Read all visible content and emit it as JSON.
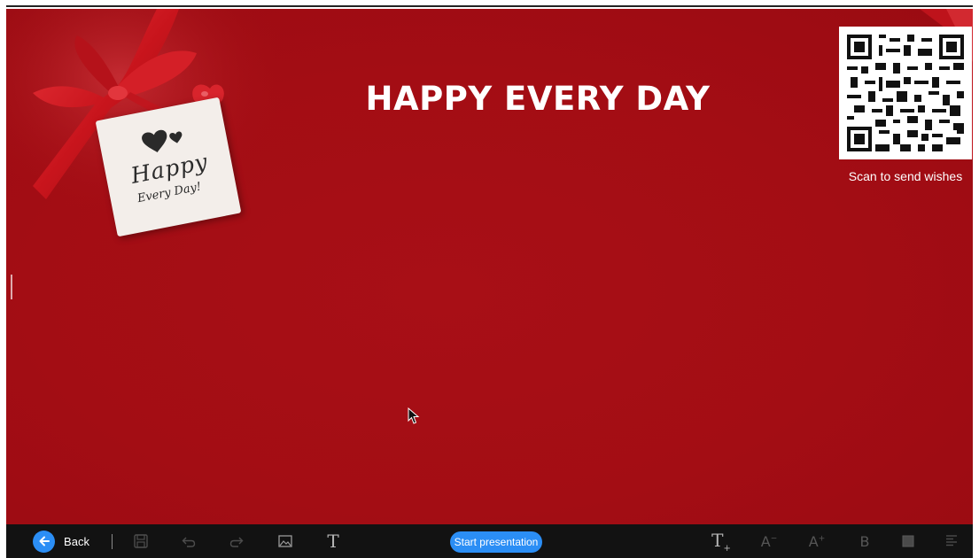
{
  "slide": {
    "headline": "HAPPY EVERY DAY",
    "tag_line1": "Happy",
    "tag_line2": "Every Day!",
    "qr_caption": "Scan to send wishes"
  },
  "toolbar": {
    "back_label": "Back",
    "start_label": "Start presentation",
    "bold_glyph": "B",
    "font_shrink_glyph": "A",
    "font_grow_glyph": "A"
  },
  "colors": {
    "background": "#a30d14",
    "accent": "#2b8ef5",
    "toolbar": "#121212"
  },
  "icons": [
    "back-arrow-icon",
    "save-icon",
    "undo-icon",
    "redo-icon",
    "image-icon",
    "text-icon",
    "text-add-icon",
    "font-decrease-icon",
    "font-increase-icon",
    "bold-icon",
    "color-fill-icon",
    "align-icon",
    "qr-code-icon",
    "mouse-cursor-icon"
  ]
}
